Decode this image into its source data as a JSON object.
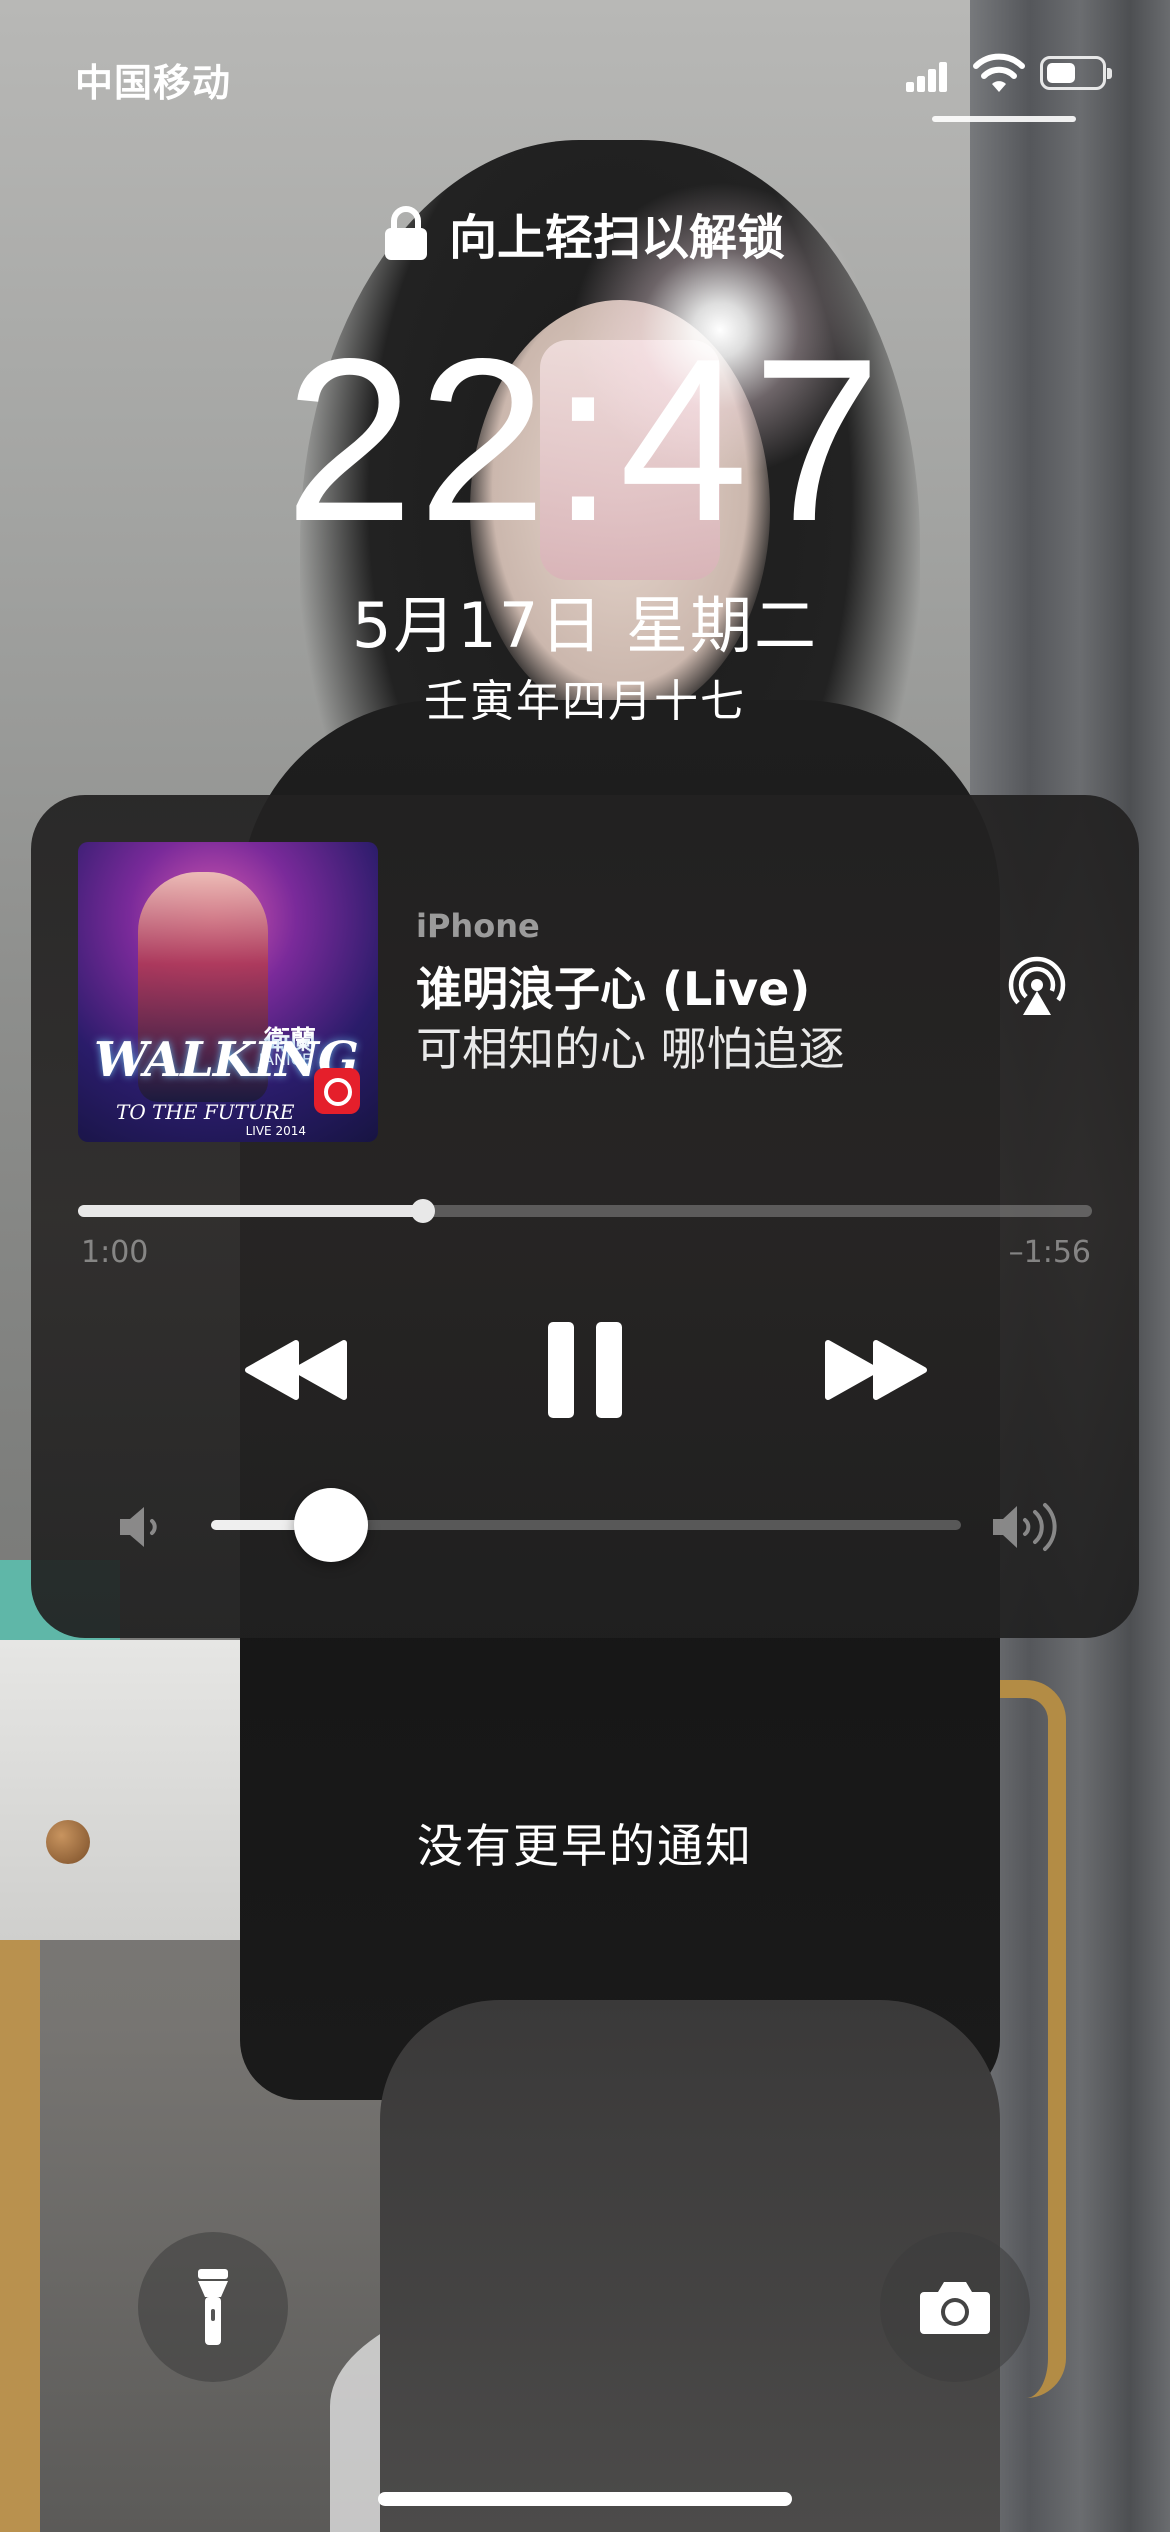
{
  "status_bar": {
    "carrier": "中国移动"
  },
  "lock_screen": {
    "unlock_hint": "向上轻扫以解锁",
    "time": "22:47",
    "date": "5月17日 星期二",
    "lunar_date": "壬寅年四月十七"
  },
  "now_playing": {
    "device": "iPhone",
    "title": "谁明浪子心 (Live)",
    "lyric": "可相知的心 哪怕追逐",
    "elapsed": "1:00",
    "remaining": "–1:56",
    "progress_fraction": 0.34,
    "volume_fraction": 0.16,
    "artwork": {
      "artist_zh": "衛蘭",
      "artist_en": "JANICE",
      "album_line1": "WALKING",
      "album_line2": "TO THE FUTURE",
      "album_line3": "LIVE 2014"
    },
    "controls": [
      "rewind-icon",
      "pause-icon",
      "fast-forward-icon",
      "airplay-icon",
      "volume-low-icon",
      "volume-high-icon"
    ]
  },
  "notifications": {
    "empty_text": "没有更早的通知"
  },
  "quick_actions": [
    "flashlight-icon",
    "camera-icon"
  ],
  "colors": {
    "player_bg": "#232222",
    "text": "#ffffff",
    "muted": "#8a8a8a",
    "netease_red": "#e51f2b"
  }
}
